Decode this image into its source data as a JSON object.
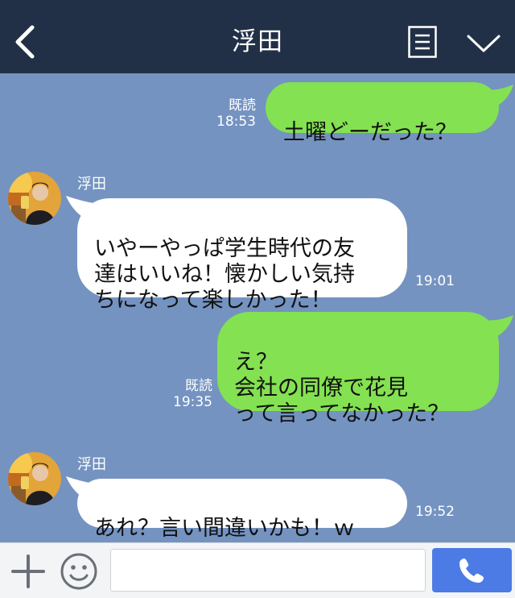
{
  "header": {
    "title": "浮田",
    "back_icon": "chevron-left-icon",
    "menu_icon": "menu-list-icon",
    "dropdown_icon": "chevron-down-icon",
    "background": "#223047"
  },
  "chat": {
    "background": "#7493c1",
    "messages": [
      {
        "side": "right",
        "read": "既読",
        "time": "18:53",
        "text": "土曜どーだった？"
      },
      {
        "side": "left",
        "sender": "浮田",
        "time": "19:01",
        "text": "いやーやっぱ学生時代の友\n達はいいね！懐かしい気持\nちになって楽しかった！"
      },
      {
        "side": "right",
        "read": "既読",
        "time": "19:35",
        "text": "え？\n会社の同僚で花見\nって言ってなかった？"
      },
      {
        "side": "left",
        "sender": "浮田",
        "time": "19:52",
        "text": "あれ？言い間違いかも！ｗ"
      }
    ],
    "colors": {
      "sent_bubble": "#84e151",
      "received_bubble": "#ffffff"
    }
  },
  "inputbar": {
    "message_value": "",
    "plus_icon": "plus-icon",
    "emoji_icon": "smiley-icon",
    "call_icon": "phone-icon",
    "call_button_color": "#4d7be5"
  }
}
